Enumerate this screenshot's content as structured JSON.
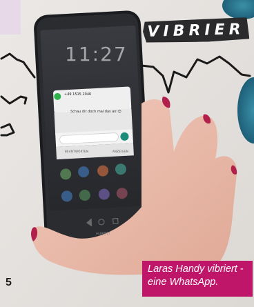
{
  "header": {
    "title": "VIBRIER"
  },
  "caption": {
    "line1": "Laras Handy vibriert -",
    "line2": "eine WhatsApp."
  },
  "page": {
    "number": "5"
  },
  "phone": {
    "lock_time": "11:27",
    "notification": {
      "sender_number": "+49 1515 2046",
      "message": "Schau dir doch mal das an!😊",
      "reply_label": "BEANTWORTEN",
      "show_label": "ANZEIGEN"
    },
    "brand": "HUAWEI"
  },
  "colors": {
    "caption_bg": "#c0166a",
    "tag_bg": "#2a2a2c",
    "whatsapp_green": "#2bb34a",
    "nail_polish": "#b0204a"
  },
  "icons": [
    "vibration-zigzag-left-icon",
    "vibration-zigzag-right-icon",
    "whatsapp-icon",
    "send-icon"
  ]
}
